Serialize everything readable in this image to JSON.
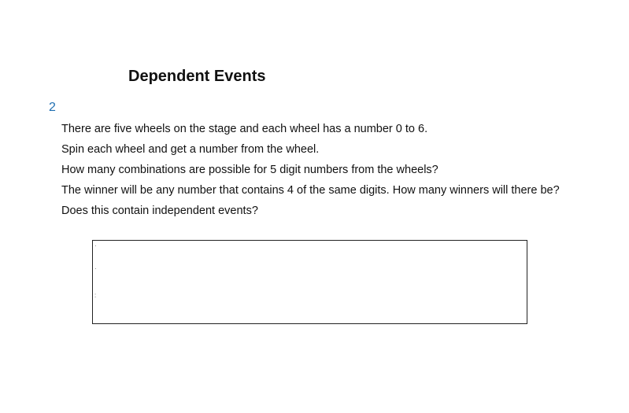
{
  "header": {
    "title": "Dependent Events"
  },
  "question": {
    "number": "2",
    "lines": [
      "There are five wheels on the stage and each wheel has a number 0 to 6.",
      "Spin each wheel and get a number from the wheel.",
      "How many combinations are possible for 5 digit numbers from the wheels?",
      "The winner will be any number that contains 4 of the same digits. How many winners will there be?",
      "Does this contain independent events?"
    ]
  }
}
